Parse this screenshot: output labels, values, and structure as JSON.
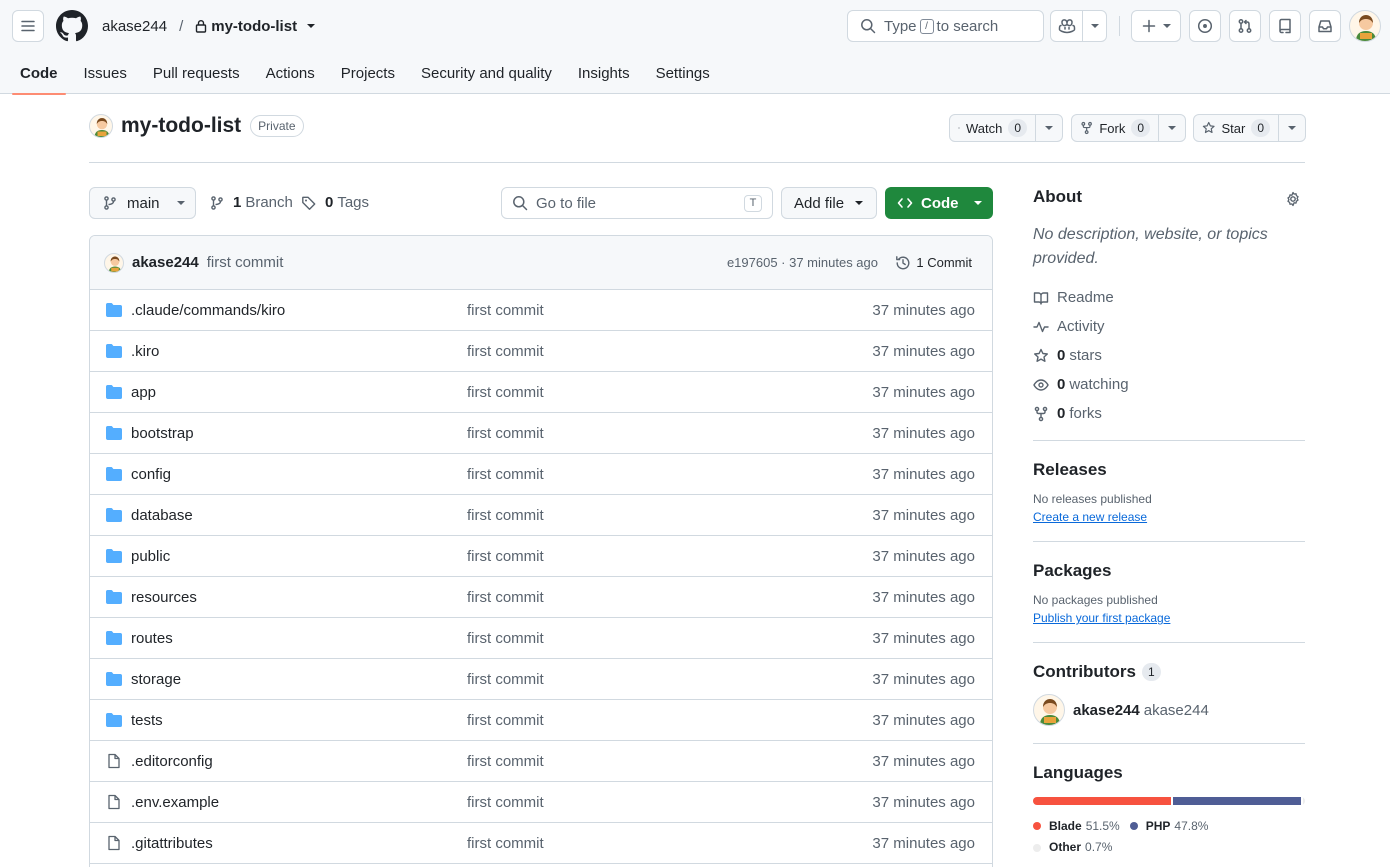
{
  "header": {
    "owner": "akase244",
    "separator": "/",
    "repo": "my-todo-list",
    "search_prefix": "Type",
    "search_key": "/",
    "search_suffix": "to search"
  },
  "tabs": [
    {
      "label": "Code",
      "active": true
    },
    {
      "label": "Issues"
    },
    {
      "label": "Pull requests"
    },
    {
      "label": "Actions"
    },
    {
      "label": "Projects"
    },
    {
      "label": "Security and quality"
    },
    {
      "label": "Insights"
    },
    {
      "label": "Settings"
    }
  ],
  "repo": {
    "name": "my-todo-list",
    "visibility": "Private",
    "watch_label": "Watch",
    "watch_count": "0",
    "fork_label": "Fork",
    "fork_count": "0",
    "star_label": "Star",
    "star_count": "0"
  },
  "toolbar": {
    "branch": "main",
    "branch_count": "1",
    "branch_label": "Branch",
    "tag_count": "0",
    "tag_label": "Tags",
    "goto_placeholder": "Go to file",
    "goto_key": "T",
    "add_file": "Add file",
    "code": "Code"
  },
  "latest_commit": {
    "author": "akase244",
    "message": "first commit",
    "meta": "e197605 · 37 minutes ago",
    "commits_label": "1 Commit"
  },
  "files": [
    {
      "name": ".claude/commands/kiro",
      "type": "dir",
      "message": "first commit",
      "age": "37 minutes ago"
    },
    {
      "name": ".kiro",
      "type": "dir",
      "message": "first commit",
      "age": "37 minutes ago"
    },
    {
      "name": "app",
      "type": "dir",
      "message": "first commit",
      "age": "37 minutes ago"
    },
    {
      "name": "bootstrap",
      "type": "dir",
      "message": "first commit",
      "age": "37 minutes ago"
    },
    {
      "name": "config",
      "type": "dir",
      "message": "first commit",
      "age": "37 minutes ago"
    },
    {
      "name": "database",
      "type": "dir",
      "message": "first commit",
      "age": "37 minutes ago"
    },
    {
      "name": "public",
      "type": "dir",
      "message": "first commit",
      "age": "37 minutes ago"
    },
    {
      "name": "resources",
      "type": "dir",
      "message": "first commit",
      "age": "37 minutes ago"
    },
    {
      "name": "routes",
      "type": "dir",
      "message": "first commit",
      "age": "37 minutes ago"
    },
    {
      "name": "storage",
      "type": "dir",
      "message": "first commit",
      "age": "37 minutes ago"
    },
    {
      "name": "tests",
      "type": "dir",
      "message": "first commit",
      "age": "37 minutes ago"
    },
    {
      "name": ".editorconfig",
      "type": "file",
      "message": "first commit",
      "age": "37 minutes ago"
    },
    {
      "name": ".env.example",
      "type": "file",
      "message": "first commit",
      "age": "37 minutes ago"
    },
    {
      "name": ".gitattributes",
      "type": "file",
      "message": "first commit",
      "age": "37 minutes ago"
    }
  ],
  "about": {
    "title": "About",
    "description": "No description, website, or topics provided.",
    "readme": "Readme",
    "activity": "Activity",
    "stars_count": "0",
    "stars_label": "stars",
    "watching_count": "0",
    "watching_label": "watching",
    "forks_count": "0",
    "forks_label": "forks"
  },
  "releases": {
    "title": "Releases",
    "none": "No releases published",
    "link": "Create a new release"
  },
  "packages": {
    "title": "Packages",
    "none": "No packages published",
    "link": "Publish your first package"
  },
  "contributors": {
    "title": "Contributors",
    "count": "1",
    "login": "akase244",
    "name": "akase244"
  },
  "languages": {
    "title": "Languages",
    "items": [
      {
        "name": "Blade",
        "percent": "51.5%",
        "share": 51.5,
        "color": "#f7523f"
      },
      {
        "name": "PHP",
        "percent": "47.8%",
        "share": 47.8,
        "color": "#4f5d95"
      },
      {
        "name": "Other",
        "percent": "0.7%",
        "share": 0.7,
        "color": "#ededed"
      }
    ]
  }
}
